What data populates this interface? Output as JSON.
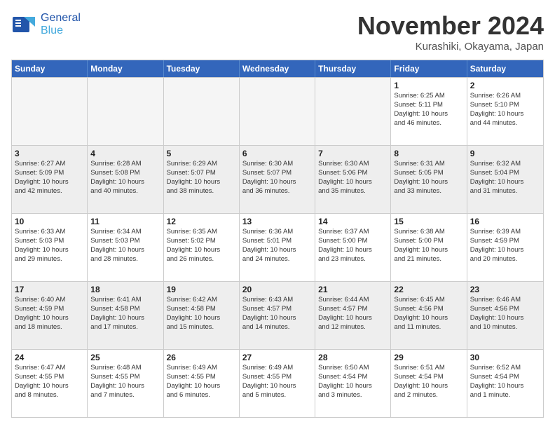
{
  "header": {
    "logo_general": "General",
    "logo_blue": "Blue",
    "month": "November 2024",
    "location": "Kurashiki, Okayama, Japan"
  },
  "days_of_week": [
    "Sunday",
    "Monday",
    "Tuesday",
    "Wednesday",
    "Thursday",
    "Friday",
    "Saturday"
  ],
  "rows": [
    [
      {
        "day": "",
        "info": "",
        "empty": true
      },
      {
        "day": "",
        "info": "",
        "empty": true
      },
      {
        "day": "",
        "info": "",
        "empty": true
      },
      {
        "day": "",
        "info": "",
        "empty": true
      },
      {
        "day": "",
        "info": "",
        "empty": true
      },
      {
        "day": "1",
        "info": "Sunrise: 6:25 AM\nSunset: 5:11 PM\nDaylight: 10 hours\nand 46 minutes.",
        "empty": false
      },
      {
        "day": "2",
        "info": "Sunrise: 6:26 AM\nSunset: 5:10 PM\nDaylight: 10 hours\nand 44 minutes.",
        "empty": false
      }
    ],
    [
      {
        "day": "3",
        "info": "Sunrise: 6:27 AM\nSunset: 5:09 PM\nDaylight: 10 hours\nand 42 minutes.",
        "empty": false
      },
      {
        "day": "4",
        "info": "Sunrise: 6:28 AM\nSunset: 5:08 PM\nDaylight: 10 hours\nand 40 minutes.",
        "empty": false
      },
      {
        "day": "5",
        "info": "Sunrise: 6:29 AM\nSunset: 5:07 PM\nDaylight: 10 hours\nand 38 minutes.",
        "empty": false
      },
      {
        "day": "6",
        "info": "Sunrise: 6:30 AM\nSunset: 5:07 PM\nDaylight: 10 hours\nand 36 minutes.",
        "empty": false
      },
      {
        "day": "7",
        "info": "Sunrise: 6:30 AM\nSunset: 5:06 PM\nDaylight: 10 hours\nand 35 minutes.",
        "empty": false
      },
      {
        "day": "8",
        "info": "Sunrise: 6:31 AM\nSunset: 5:05 PM\nDaylight: 10 hours\nand 33 minutes.",
        "empty": false
      },
      {
        "day": "9",
        "info": "Sunrise: 6:32 AM\nSunset: 5:04 PM\nDaylight: 10 hours\nand 31 minutes.",
        "empty": false
      }
    ],
    [
      {
        "day": "10",
        "info": "Sunrise: 6:33 AM\nSunset: 5:03 PM\nDaylight: 10 hours\nand 29 minutes.",
        "empty": false
      },
      {
        "day": "11",
        "info": "Sunrise: 6:34 AM\nSunset: 5:03 PM\nDaylight: 10 hours\nand 28 minutes.",
        "empty": false
      },
      {
        "day": "12",
        "info": "Sunrise: 6:35 AM\nSunset: 5:02 PM\nDaylight: 10 hours\nand 26 minutes.",
        "empty": false
      },
      {
        "day": "13",
        "info": "Sunrise: 6:36 AM\nSunset: 5:01 PM\nDaylight: 10 hours\nand 24 minutes.",
        "empty": false
      },
      {
        "day": "14",
        "info": "Sunrise: 6:37 AM\nSunset: 5:00 PM\nDaylight: 10 hours\nand 23 minutes.",
        "empty": false
      },
      {
        "day": "15",
        "info": "Sunrise: 6:38 AM\nSunset: 5:00 PM\nDaylight: 10 hours\nand 21 minutes.",
        "empty": false
      },
      {
        "day": "16",
        "info": "Sunrise: 6:39 AM\nSunset: 4:59 PM\nDaylight: 10 hours\nand 20 minutes.",
        "empty": false
      }
    ],
    [
      {
        "day": "17",
        "info": "Sunrise: 6:40 AM\nSunset: 4:59 PM\nDaylight: 10 hours\nand 18 minutes.",
        "empty": false
      },
      {
        "day": "18",
        "info": "Sunrise: 6:41 AM\nSunset: 4:58 PM\nDaylight: 10 hours\nand 17 minutes.",
        "empty": false
      },
      {
        "day": "19",
        "info": "Sunrise: 6:42 AM\nSunset: 4:58 PM\nDaylight: 10 hours\nand 15 minutes.",
        "empty": false
      },
      {
        "day": "20",
        "info": "Sunrise: 6:43 AM\nSunset: 4:57 PM\nDaylight: 10 hours\nand 14 minutes.",
        "empty": false
      },
      {
        "day": "21",
        "info": "Sunrise: 6:44 AM\nSunset: 4:57 PM\nDaylight: 10 hours\nand 12 minutes.",
        "empty": false
      },
      {
        "day": "22",
        "info": "Sunrise: 6:45 AM\nSunset: 4:56 PM\nDaylight: 10 hours\nand 11 minutes.",
        "empty": false
      },
      {
        "day": "23",
        "info": "Sunrise: 6:46 AM\nSunset: 4:56 PM\nDaylight: 10 hours\nand 10 minutes.",
        "empty": false
      }
    ],
    [
      {
        "day": "24",
        "info": "Sunrise: 6:47 AM\nSunset: 4:55 PM\nDaylight: 10 hours\nand 8 minutes.",
        "empty": false
      },
      {
        "day": "25",
        "info": "Sunrise: 6:48 AM\nSunset: 4:55 PM\nDaylight: 10 hours\nand 7 minutes.",
        "empty": false
      },
      {
        "day": "26",
        "info": "Sunrise: 6:49 AM\nSunset: 4:55 PM\nDaylight: 10 hours\nand 6 minutes.",
        "empty": false
      },
      {
        "day": "27",
        "info": "Sunrise: 6:49 AM\nSunset: 4:55 PM\nDaylight: 10 hours\nand 5 minutes.",
        "empty": false
      },
      {
        "day": "28",
        "info": "Sunrise: 6:50 AM\nSunset: 4:54 PM\nDaylight: 10 hours\nand 3 minutes.",
        "empty": false
      },
      {
        "day": "29",
        "info": "Sunrise: 6:51 AM\nSunset: 4:54 PM\nDaylight: 10 hours\nand 2 minutes.",
        "empty": false
      },
      {
        "day": "30",
        "info": "Sunrise: 6:52 AM\nSunset: 4:54 PM\nDaylight: 10 hours\nand 1 minute.",
        "empty": false
      }
    ]
  ]
}
